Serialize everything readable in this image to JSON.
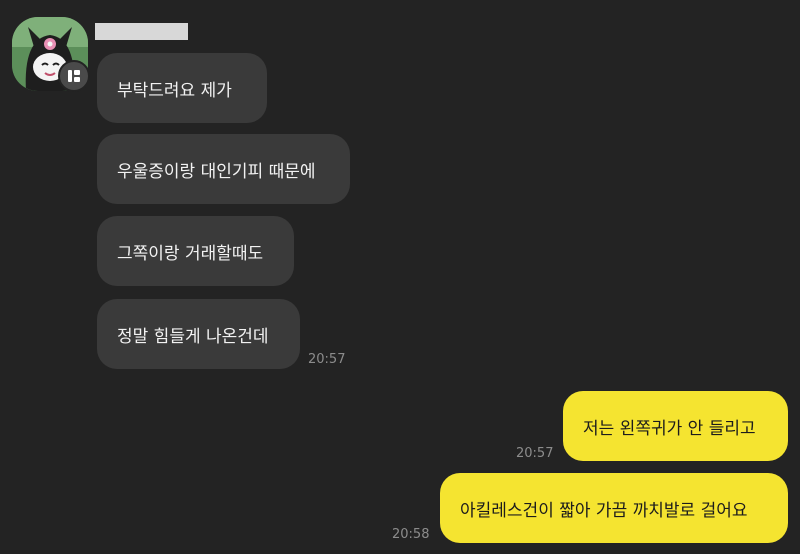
{
  "colors": {
    "background": "#232323",
    "incoming_bubble": "#3a3a3a",
    "outgoing_bubble": "#f5e430"
  },
  "icons": {
    "avatar": "kuromi-avatar-icon",
    "badge": "profile-badge-icon"
  },
  "incoming": [
    {
      "text": "부탁드려요 제가"
    },
    {
      "text": "우울증이랑 대인기피 때문에"
    },
    {
      "text": "그쪽이랑 거래할때도"
    },
    {
      "text": "정말 힘들게 나온건데",
      "time": "20:57"
    }
  ],
  "outgoing": [
    {
      "text": "저는 왼쪽귀가 안 들리고",
      "time": "20:57"
    },
    {
      "text": "아킬레스건이 짧아 가끔 까치발로 걸어요",
      "time": "20:58"
    }
  ]
}
